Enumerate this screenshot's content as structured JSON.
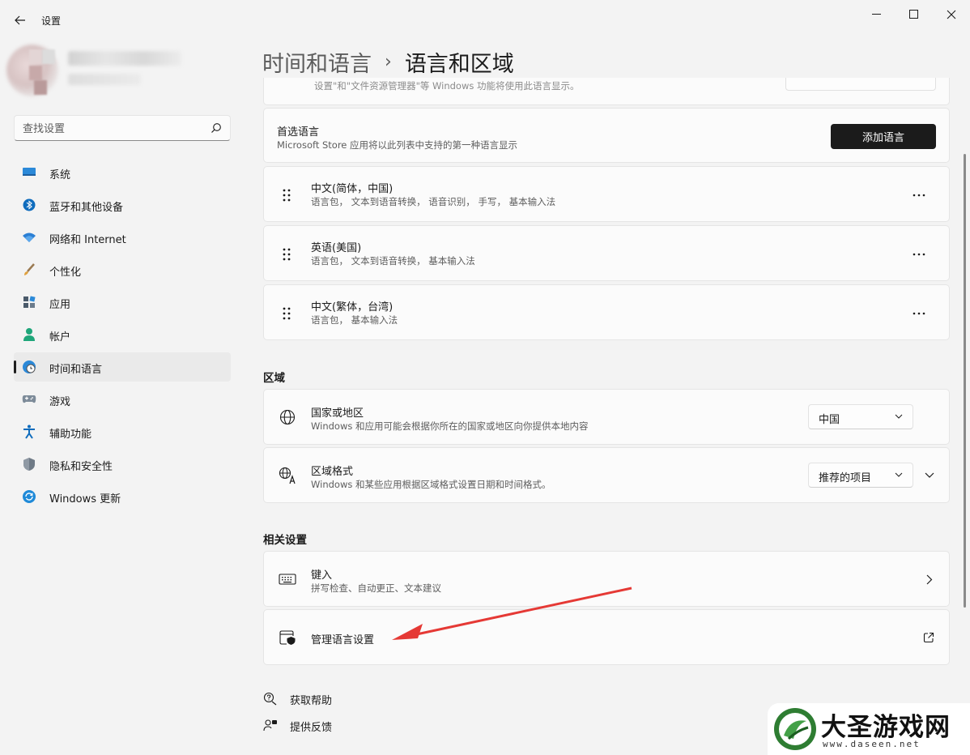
{
  "window": {
    "title": "设置",
    "back_icon": "back-arrow-icon",
    "minimize_icon": "minimize-icon",
    "maximize_icon": "maximize-icon",
    "close_icon": "close-icon"
  },
  "search": {
    "placeholder": "查找设置",
    "icon": "search-icon"
  },
  "sidebar": {
    "items": [
      {
        "label": "系统",
        "icon": "monitor-icon",
        "active": false
      },
      {
        "label": "蓝牙和其他设备",
        "icon": "bluetooth-icon",
        "active": false
      },
      {
        "label": "网络和 Internet",
        "icon": "wifi-icon",
        "active": false
      },
      {
        "label": "个性化",
        "icon": "brush-icon",
        "active": false
      },
      {
        "label": "应用",
        "icon": "apps-icon",
        "active": false
      },
      {
        "label": "帐户",
        "icon": "person-icon",
        "active": false
      },
      {
        "label": "时间和语言",
        "icon": "clock-globe-icon",
        "active": true
      },
      {
        "label": "游戏",
        "icon": "gamepad-icon",
        "active": false
      },
      {
        "label": "辅助功能",
        "icon": "accessibility-icon",
        "active": false
      },
      {
        "label": "隐私和安全性",
        "icon": "shield-icon",
        "active": false
      },
      {
        "label": "Windows 更新",
        "icon": "update-icon",
        "active": false
      }
    ]
  },
  "breadcrumb": {
    "parent": "时间和语言",
    "separator": "›",
    "current": "语言和区域"
  },
  "cutoff_row": {
    "text": "设置\"和\"文件资源管理器\"等 Windows 功能将使用此语言显示。"
  },
  "preferred_languages": {
    "title": "首选语言",
    "subtitle": "Microsoft Store 应用将以此列表中支持的第一种语言显示",
    "add_button": "添加语言",
    "languages": [
      {
        "name": "中文(简体，中国)",
        "features": "语言包， 文本到语音转换， 语音识别， 手写， 基本输入法"
      },
      {
        "name": "英语(美国)",
        "features": "语言包， 文本到语音转换， 基本输入法"
      },
      {
        "name": "中文(繁体，台湾)",
        "features": "语言包， 基本输入法"
      }
    ]
  },
  "region": {
    "heading": "区域",
    "country": {
      "title": "国家或地区",
      "subtitle": "Windows 和应用可能会根据你所在的国家或地区向你提供本地内容",
      "value": "中国",
      "icon": "globe-icon"
    },
    "format": {
      "title": "区域格式",
      "subtitle": "Windows 和某些应用根据区域格式设置日期和时间格式。",
      "value": "推荐的项目",
      "icon": "region-format-icon"
    }
  },
  "related": {
    "heading": "相关设置",
    "typing": {
      "title": "键入",
      "subtitle": "拼写检查、自动更正、文本建议",
      "icon": "keyboard-icon"
    },
    "admin_language": {
      "title": "管理语言设置",
      "icon": "admin-shield-icon",
      "link_icon": "external-link-icon"
    }
  },
  "footer": {
    "help": "获取帮助",
    "feedback": "提供反馈"
  },
  "watermark": {
    "name": "大圣游戏网",
    "url": "www.daseen.net"
  },
  "colors": {
    "background": "#f3f3f3",
    "card": "#fbfbfb",
    "accent_button": "#1b1b1b",
    "annotation_arrow": "#e53935",
    "windows_blue": "#0067c0"
  }
}
